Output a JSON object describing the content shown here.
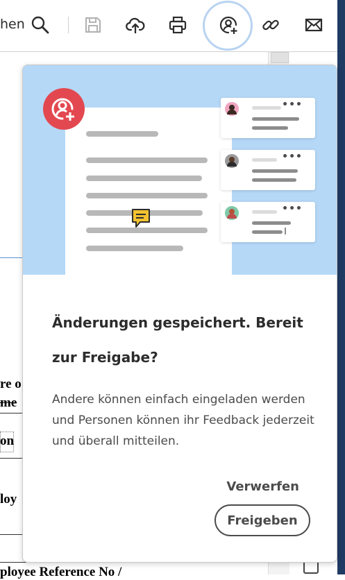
{
  "toolbar": {
    "truncated_label": "hen",
    "icons": [
      "search-icon",
      "save-icon",
      "cloud-upload-icon",
      "print-icon",
      "share-user-icon",
      "link-icon",
      "email-icon"
    ]
  },
  "document": {
    "fragments": [
      "re o",
      "me",
      "on",
      "loy",
      "ployee Reference No /"
    ]
  },
  "popover": {
    "title_line1": "Änderungen gespeichert. Bereit",
    "title_line2": "zur Freigabe?",
    "body": "Andere können einfach eingeladen werden und Personen können ihr Feedback jederzeit und überall mitteilen.",
    "discard_label": "Verwerfen",
    "share_label": "Freigeben"
  },
  "colors": {
    "accent_red": "#e34850",
    "hero_blue": "#b5d8f7",
    "ring_blue": "#b9d3f1",
    "text_dark": "#2c2c2c"
  }
}
